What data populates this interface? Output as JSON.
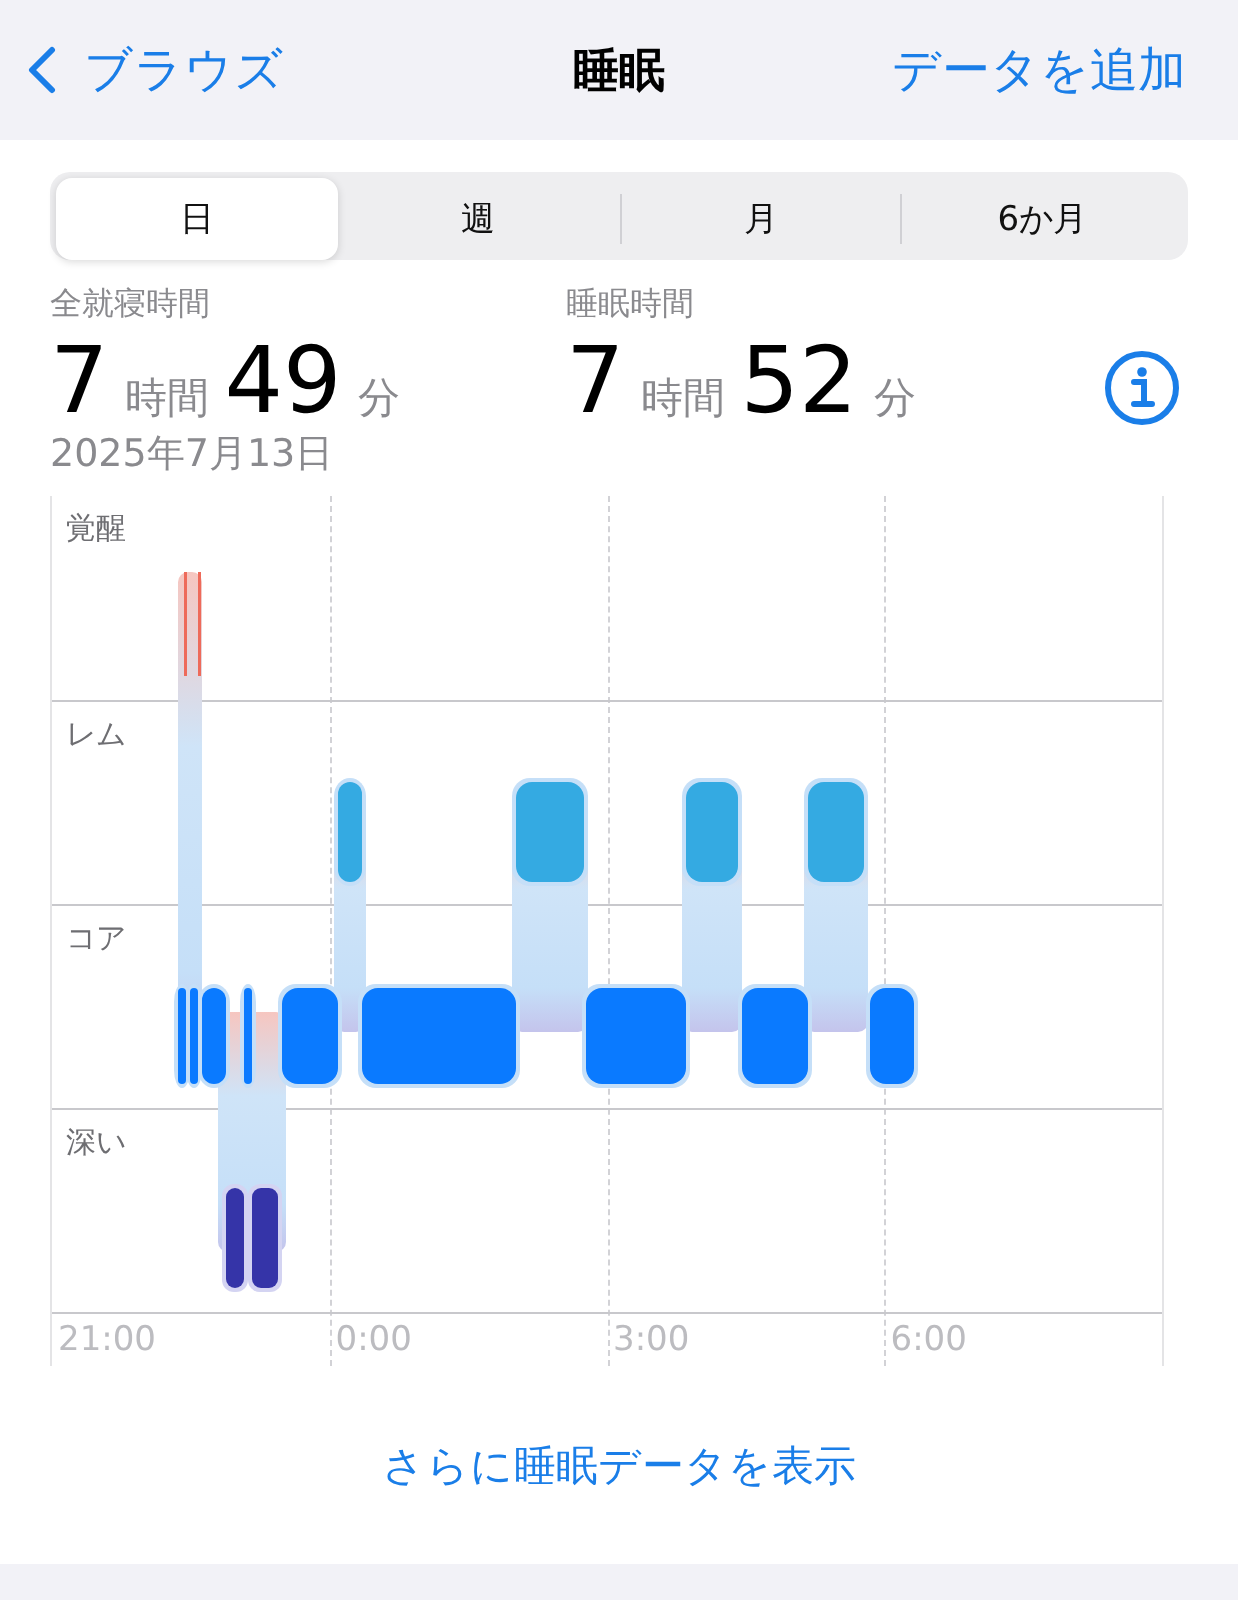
{
  "nav": {
    "back": "ブラウズ",
    "title": "睡眠",
    "action": "データを追加"
  },
  "tabs": [
    {
      "label": "日",
      "selected": true
    },
    {
      "label": "週",
      "selected": false
    },
    {
      "label": "月",
      "selected": false
    },
    {
      "label": "6か月",
      "selected": false
    }
  ],
  "stats": [
    {
      "label": "全就寝時間",
      "parts": [
        {
          "kind": "number",
          "text": "7"
        },
        {
          "kind": "unit",
          "text": "時間"
        },
        {
          "kind": "number",
          "text": "49"
        },
        {
          "kind": "unit",
          "text": "分"
        }
      ]
    },
    {
      "label": "睡眠時間",
      "parts": [
        {
          "kind": "number",
          "text": "7"
        },
        {
          "kind": "unit",
          "text": "時間"
        },
        {
          "kind": "number",
          "text": "52"
        },
        {
          "kind": "unit",
          "text": "分"
        }
      ]
    }
  ],
  "date": "2025年7月13日",
  "chart": {
    "stages": [
      "覚醒",
      "レム",
      "コア",
      "深い"
    ],
    "ticks": [
      "21:00",
      "0:00",
      "3:00",
      "6:00"
    ]
  },
  "more_link": "さらに睡眠データを表示"
}
